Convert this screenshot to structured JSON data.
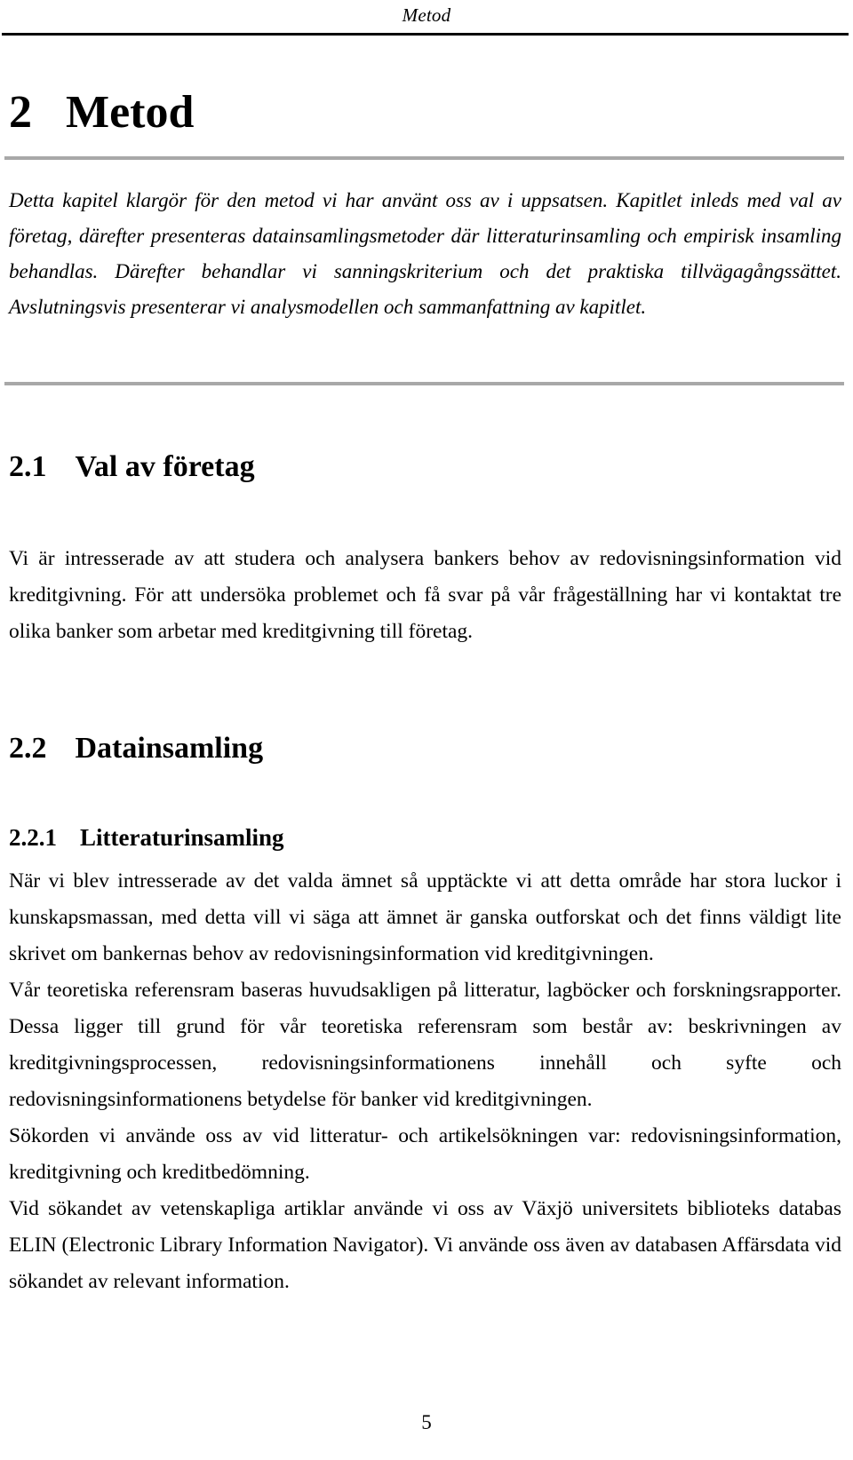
{
  "document": {
    "running_header": "Metod",
    "page_number": "5",
    "chapter": {
      "number": "2",
      "title": "Metod"
    },
    "intro_paragraph": "Detta kapitel klargör för den metod vi har använt oss av i uppsatsen. Kapitlet inleds med val av företag, därefter presenteras datainsamlingsmetoder där litteraturinsamling och empirisk insamling behandlas. Därefter behandlar vi sanningskriterium och det praktiska tillvägagångssättet. Avslutningsvis presenterar vi analysmodellen och sammanfattning av kapitlet.",
    "sections": [
      {
        "number": "2.1",
        "title": "Val av företag",
        "paragraphs": [
          "Vi är intresserade av att studera och analysera bankers behov av redovisningsinformation vid kreditgivning. För att undersöka problemet och få svar på vår frågeställning har vi kontaktat tre olika banker som arbetar med kreditgivning till företag."
        ]
      },
      {
        "number": "2.2",
        "title": "Datainsamling",
        "subsections": [
          {
            "number": "2.2.1",
            "title": "Litteraturinsamling",
            "paragraphs": [
              "När vi blev intresserade av det valda ämnet så upptäckte vi att detta område har stora luckor i kunskapsmassan, med detta vill vi säga att ämnet är ganska outforskat och det finns väldigt lite skrivet om bankernas behov av redovisningsinformation vid kreditgivningen.",
              "Vår teoretiska referensram baseras huvudsakligen på litteratur, lagböcker och forskningsrapporter. Dessa ligger till grund för vår teoretiska referensram som består av: beskrivningen av kreditgivningsprocessen, redovisningsinformationens innehåll och syfte och redovisningsinformationens betydelse för banker vid kreditgivningen.",
              "Sökorden vi använde oss av vid litteratur- och artikelsökningen var: redovisningsinformation, kreditgivning och kreditbedömning.",
              "Vid sökandet av vetenskapliga artiklar använde vi oss av Växjö universitets biblioteks databas ELIN (Electronic Library Information Navigator). Vi använde oss även av databasen Affärsdata vid sökandet av relevant information."
            ]
          }
        ]
      }
    ]
  },
  "colors": {
    "text": "#000000",
    "rule_dark": "#000000",
    "rule_gray": "#a8a8a8",
    "background": "#ffffff"
  }
}
